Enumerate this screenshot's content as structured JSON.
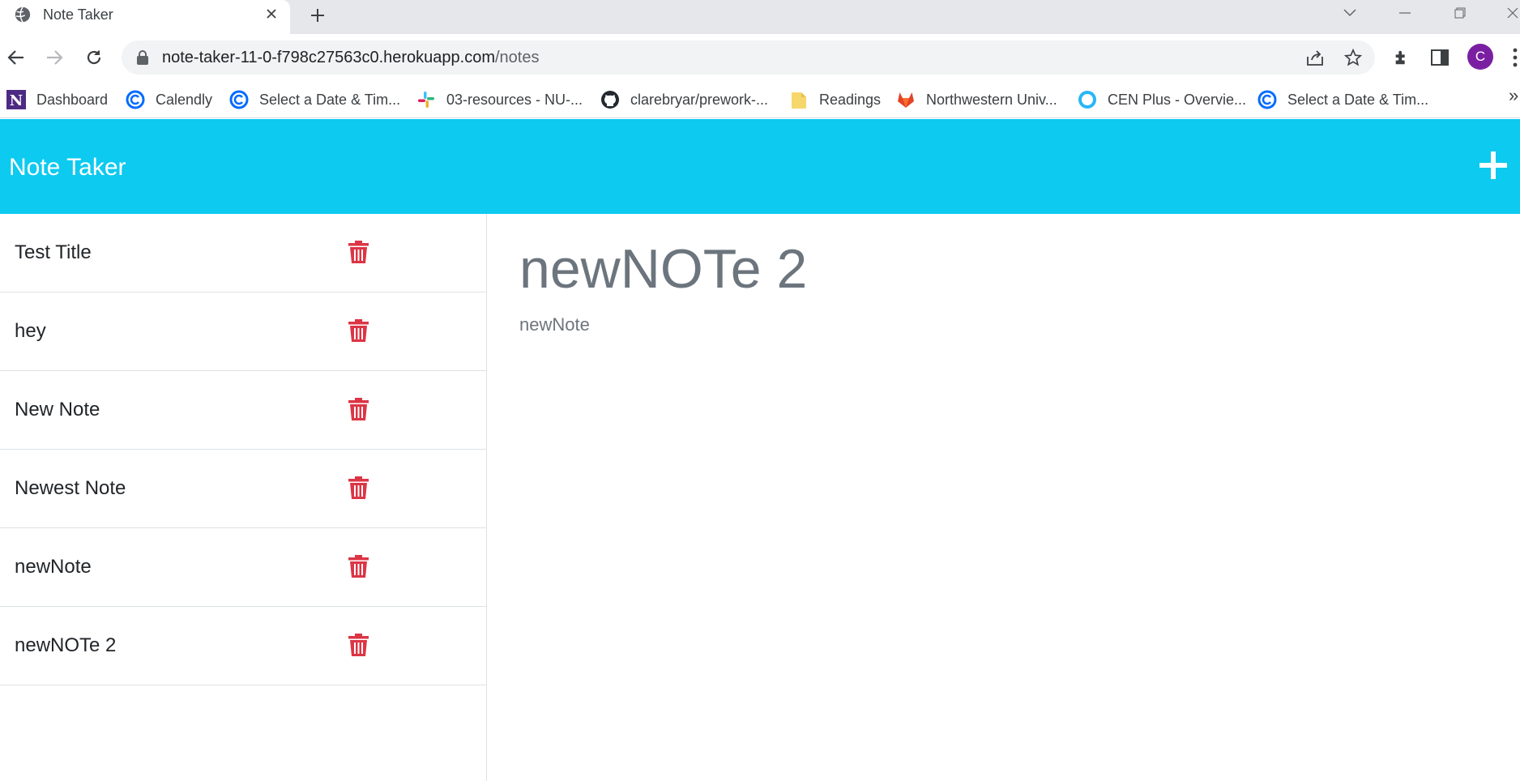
{
  "browser": {
    "tab_title": "Note Taker",
    "url_host": "note-taker-11-0-f798c27563c0.herokuapp.com",
    "url_path": "/notes",
    "profile_initial": "C",
    "bookmarks": [
      {
        "label": "Dashboard",
        "icon": "northwestern-n-icon",
        "color": "#4e2a84"
      },
      {
        "label": "Calendly",
        "icon": "calendly-icon",
        "color": "#006bff"
      },
      {
        "label": "Select a Date & Tim...",
        "icon": "calendly-icon",
        "color": "#006bff"
      },
      {
        "label": "03-resources - NU-...",
        "icon": "slack-icon",
        "color": "#e01e5a"
      },
      {
        "label": "clarebryar/prework-...",
        "icon": "github-icon",
        "color": "#24292f"
      },
      {
        "label": "Readings",
        "icon": "folder-icon",
        "color": "#f6d76b"
      },
      {
        "label": "Northwestern Univ...",
        "icon": "gitlab-icon",
        "color": "#e24329"
      },
      {
        "label": "CEN Plus - Overvie...",
        "icon": "cen-circle-icon",
        "color": "#29b6f6"
      },
      {
        "label": "Select a Date & Tim...",
        "icon": "calendly-icon",
        "color": "#006bff"
      }
    ],
    "more_bookmarks": "»"
  },
  "app": {
    "brand": "Note Taker",
    "header_color": "#0dcaf0",
    "trash_color": "#dc3545",
    "notes": [
      {
        "title": "Test Title"
      },
      {
        "title": "hey"
      },
      {
        "title": "New Note"
      },
      {
        "title": "Newest Note"
      },
      {
        "title": "newNote"
      },
      {
        "title": "newNOTe 2"
      }
    ],
    "active_note": {
      "title": "newNOTe 2",
      "text": "newNote"
    }
  }
}
